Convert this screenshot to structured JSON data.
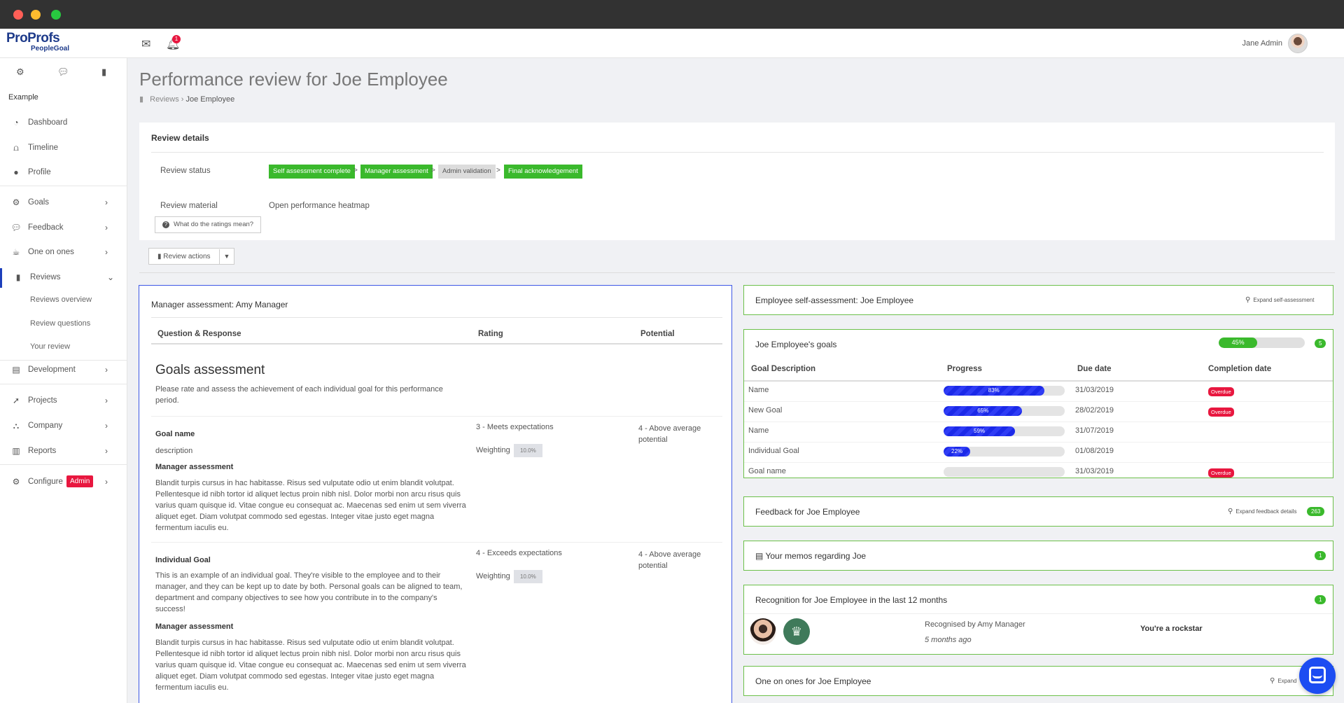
{
  "app": {
    "logo_main": "ProProfs",
    "logo_sub": "PeopleGoal",
    "notification_count": "1",
    "user_name": "Jane Admin"
  },
  "sidebar": {
    "section_label": "Example",
    "items": [
      {
        "label": "Dashboard",
        "icon": "dashboard-icon"
      },
      {
        "label": "Timeline",
        "icon": "timeline-icon"
      },
      {
        "label": "Profile",
        "icon": "profile-icon"
      },
      {
        "label": "Goals",
        "icon": "goals-icon"
      },
      {
        "label": "Feedback",
        "icon": "feedback-icon"
      },
      {
        "label": "One on ones",
        "icon": "one-on-ones-icon"
      },
      {
        "label": "Reviews",
        "icon": "reviews-icon"
      },
      {
        "label": "Development",
        "icon": "development-icon"
      },
      {
        "label": "Projects",
        "icon": "projects-icon"
      },
      {
        "label": "Company",
        "icon": "company-icon"
      },
      {
        "label": "Reports",
        "icon": "reports-icon"
      },
      {
        "label": "Configure",
        "icon": "configure-icon"
      }
    ],
    "reviews_sub": [
      "Reviews overview",
      "Review questions",
      "Your review"
    ],
    "admin_badge": "Admin"
  },
  "page": {
    "title": "Performance review for Joe Employee",
    "breadcrumb": [
      "Reviews",
      "Joe Employee"
    ]
  },
  "review_details": {
    "heading": "Review details",
    "status_label": "Review status",
    "steps": [
      {
        "label": "Self assessment complete",
        "state": "done"
      },
      {
        "label": "Manager assessment",
        "state": "done"
      },
      {
        "label": "Admin validation",
        "state": "pending"
      },
      {
        "label": "Final acknowledgement",
        "state": "done"
      }
    ],
    "material_label": "Review material",
    "material_value": "Open performance heatmap",
    "ratings_button": "What do the ratings mean?",
    "actions_button": "Review actions"
  },
  "manager": {
    "title": "Manager assessment: Amy Manager",
    "columns": [
      "Question & Response",
      "Rating",
      "Potential"
    ],
    "section_title": "Goals assessment",
    "section_desc": "Please rate and assess the achievement of each individual goal for this performance period.",
    "weighting_label": "Weighting",
    "assessment_label": "Manager assessment",
    "goals": [
      {
        "name": "Goal name",
        "description": "description",
        "rating": "3 - Meets expectations",
        "weight": "10.0%",
        "potential": "4 - Above average potential",
        "assessment": "Blandit turpis cursus in hac habitasse. Risus sed vulputate odio ut enim blandit volutpat. Pellentesque id nibh tortor id aliquet lectus proin nibh nisl. Dolor morbi non arcu risus quis varius quam quisque id. Vitae congue eu consequat ac. Maecenas sed enim ut sem viverra aliquet eget. Diam volutpat commodo sed egestas. Integer vitae justo eget magna fermentum iaculis eu."
      },
      {
        "name": "Individual Goal",
        "description": "This is an example of an individual goal. They're visible to the employee and to their manager, and they can be kept up to date by both. Personal goals can be aligned to team, department and company objectives to see how you contribute in to the company's success!",
        "rating": "4 - Exceeds expectations",
        "weight": "10.0%",
        "potential": "4 - Above average potential",
        "assessment": "Blandit turpis cursus in hac habitasse. Risus sed vulputate odio ut enim blandit volutpat. Pellentesque id nibh tortor id aliquet lectus proin nibh nisl. Dolor morbi non arcu risus quis varius quam quisque id. Vitae congue eu consequat ac. Maecenas sed enim ut sem viverra aliquet eget. Diam volutpat commodo sed egestas. Integer vitae justo eget magna fermentum iaculis eu."
      }
    ]
  },
  "self_assessment": {
    "title": "Employee self-assessment: Joe Employee",
    "expand": "Expand self-assessment"
  },
  "goals_panel": {
    "title": "Joe Employee's goals",
    "overall_progress": "45%",
    "overall_fraction": 0.45,
    "count": "5",
    "columns": [
      "Goal Description",
      "Progress",
      "Due date",
      "Completion date"
    ],
    "rows": [
      {
        "name": "Name",
        "progress": "83%",
        "fraction": 0.83,
        "due": "31/03/2019",
        "status": "Overdue"
      },
      {
        "name": "New Goal",
        "progress": "65%",
        "fraction": 0.65,
        "due": "28/02/2019",
        "status": "Overdue"
      },
      {
        "name": "Name",
        "progress": "59%",
        "fraction": 0.59,
        "due": "31/07/2019",
        "status": ""
      },
      {
        "name": "Individual Goal",
        "progress": "22%",
        "fraction": 0.22,
        "due": "01/08/2019",
        "status": ""
      },
      {
        "name": "Goal name",
        "progress": "",
        "fraction": 0,
        "due": "31/03/2019",
        "status": "Overdue"
      }
    ]
  },
  "feedback": {
    "title": "Feedback for Joe Employee",
    "expand": "Expand feedback details",
    "count": "263"
  },
  "memos": {
    "title": "Your memos regarding Joe",
    "count": "1"
  },
  "recognition": {
    "title": "Recognition for Joe Employee in the last 12 months",
    "count": "1",
    "by": "Recognised by Amy Manager",
    "when": "5 months ago",
    "message": "You're a rockstar"
  },
  "one_on_ones": {
    "title": "One on ones for Joe Employee",
    "expand": "Expand"
  },
  "colors": {
    "accent_blue": "#1d3fbb",
    "success_green": "#3ab92c",
    "danger_red": "#e8173f",
    "progress_blue": "#1b29e8"
  }
}
